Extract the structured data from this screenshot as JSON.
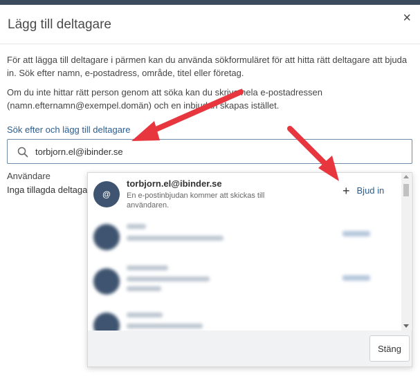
{
  "dialog": {
    "title": "Lägg till deltagare",
    "close_symbol": "×",
    "intro_1": "För att lägga till deltagare i pärmen kan du använda sökformuläret för att hitta rätt deltagare att bjuda in. Sök efter namn, e-postadress, område, titel eller företag.",
    "intro_2": "Om du inte hittar rätt person genom att söka kan du skriva hela e-postadressen (namn.efternamn@exempel.domän) och en inbjudan skapas istället."
  },
  "search": {
    "label": "Sök efter och lägg till deltagare",
    "value": "torbjorn.el@ibinder.se",
    "icon": "search-icon"
  },
  "users": {
    "label": "Användare",
    "empty_text": "Inga tillagda deltagare"
  },
  "dropdown": {
    "invite_item": {
      "avatar_symbol": "@",
      "email": "torbjorn.el@ibinder.se",
      "description": "En e-postinbjudan kommer att skickas till användaren.",
      "invite_label": "Bjud in",
      "invite_icon": "plus-icon"
    },
    "blurred_results": [
      "blurred-1",
      "blurred-2",
      "blurred-3"
    ],
    "close_label": "Stäng"
  },
  "annotations": {
    "arrow_color": "#e8363f"
  }
}
